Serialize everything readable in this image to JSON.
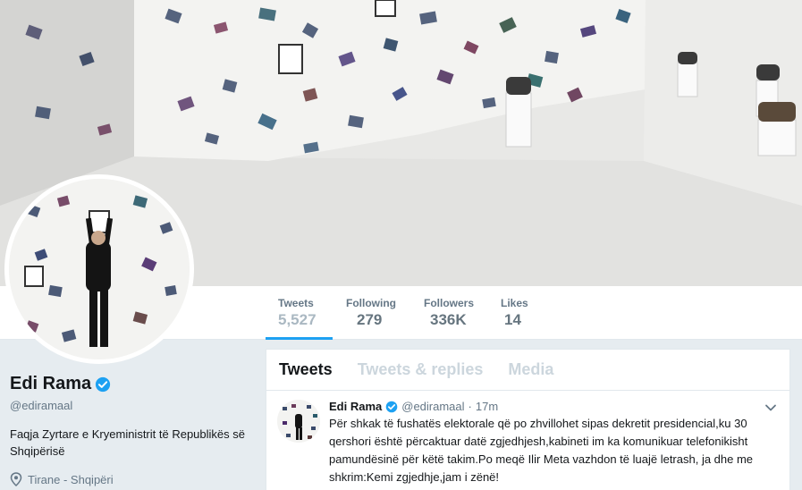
{
  "profile": {
    "name": "Edi Rama",
    "handle": "@ediramaal",
    "bio": "Faqja Zyrtare e Kryeministrit të Republikës së Shqipërisë",
    "location": "Tirane - Shqipëri"
  },
  "stats": [
    {
      "label": "Tweets",
      "value": "5,527"
    },
    {
      "label": "Following",
      "value": "279"
    },
    {
      "label": "Followers",
      "value": "336K"
    },
    {
      "label": "Likes",
      "value": "14"
    }
  ],
  "tabs": [
    "Tweets",
    "Tweets & replies",
    "Media"
  ],
  "tweet": {
    "name": "Edi Rama",
    "handle": "@ediramaal",
    "separator": "·",
    "time": "17m",
    "text": "Për shkak të fushatës elektorale që po zhvillohet sipas dekretit presidencial,ku 30 qershori është përcaktuar datë zgjedhjesh,kabineti im ka komunikuar telefonikisht pamundësinë për këtë takim.Po meqë Ilir Meta vazhdon të luajë letrash, ja dhe me shkrim:Kemi zgjedhje,jam i zënë!"
  },
  "colors": {
    "accent": "#1da1f2",
    "background": "#e6ecf0",
    "muted": "#657786",
    "inactive_tab": "#ccd6dd"
  },
  "icons": {
    "verified": "verified-badge-icon",
    "location": "location-pin-icon",
    "caret": "chevron-down-icon"
  }
}
